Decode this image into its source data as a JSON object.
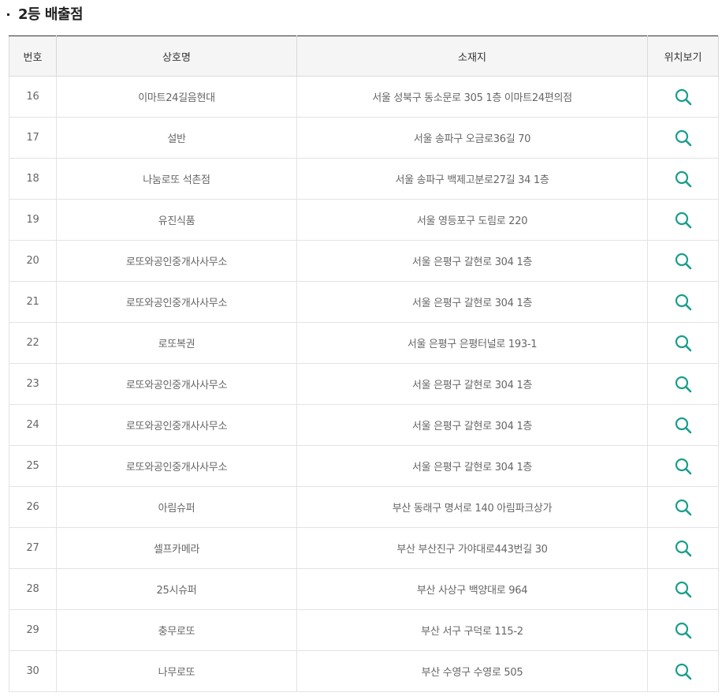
{
  "section": {
    "title": "2등 배출점"
  },
  "table": {
    "headers": [
      "번호",
      "상호명",
      "소재지",
      "위치보기"
    ],
    "rows": [
      {
        "no": "16",
        "name": "이마트24길음현대",
        "address": "서울 성북구 동소문로 305 1층 이마트24편의점"
      },
      {
        "no": "17",
        "name": "설반",
        "address": "서울 송파구 오금로36길 70"
      },
      {
        "no": "18",
        "name": "나눔로또 석촌점",
        "address": "서울 송파구 백제고분로27길 34 1층"
      },
      {
        "no": "19",
        "name": "유진식품",
        "address": "서울 영등포구 도림로 220"
      },
      {
        "no": "20",
        "name": "로또와공인중개사사무소",
        "address": "서울 은평구 갈현로 304 1층"
      },
      {
        "no": "21",
        "name": "로또와공인중개사사무소",
        "address": "서울 은평구 갈현로 304 1층"
      },
      {
        "no": "22",
        "name": "로또복권",
        "address": "서울 은평구 은평터널로 193-1"
      },
      {
        "no": "23",
        "name": "로또와공인중개사사무소",
        "address": "서울 은평구 갈현로 304 1층"
      },
      {
        "no": "24",
        "name": "로또와공인중개사사무소",
        "address": "서울 은평구 갈현로 304 1층"
      },
      {
        "no": "25",
        "name": "로또와공인중개사사무소",
        "address": "서울 은평구 갈현로 304 1층"
      },
      {
        "no": "26",
        "name": "아림슈퍼",
        "address": "부산 동래구 명서로 140 아림파크상가"
      },
      {
        "no": "27",
        "name": "셀프카메라",
        "address": "부산 부산진구 가야대로443번길 30"
      },
      {
        "no": "28",
        "name": "25시슈퍼",
        "address": "부산 사상구 백양대로 964"
      },
      {
        "no": "29",
        "name": "충무로또",
        "address": "부산 서구 구덕로 115-2"
      },
      {
        "no": "30",
        "name": "나무로또",
        "address": "부산 수영구 수영로 505"
      }
    ],
    "map_icon": "search-icon"
  },
  "colors": {
    "accent": "#1a9e8c",
    "header_bg": "#f5f5f5",
    "header_top_border": "#333333"
  }
}
